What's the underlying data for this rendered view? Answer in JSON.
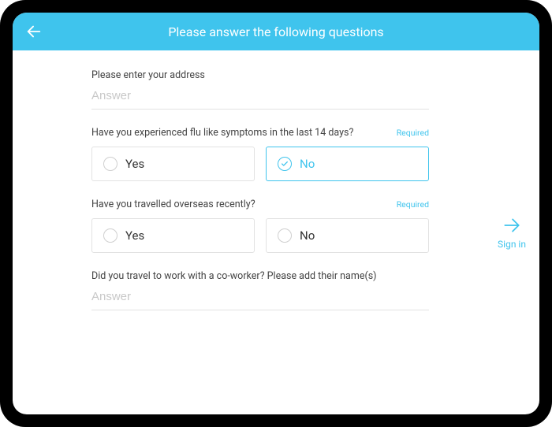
{
  "header": {
    "title": "Please answer the following questions"
  },
  "side": {
    "label": "Sign in"
  },
  "questions": {
    "q1": {
      "label": "Please enter your address",
      "placeholder": "Answer"
    },
    "q2": {
      "label": "Have you experienced flu like symptoms in the last 14 days?",
      "required_text": "Required",
      "opt_yes": "Yes",
      "opt_no": "No",
      "selected": "no"
    },
    "q3": {
      "label": "Have you travelled overseas recently?",
      "required_text": "Required",
      "opt_yes": "Yes",
      "opt_no": "No"
    },
    "q4": {
      "label": "Did you travel to work with a co-worker? Please add their name(s)",
      "placeholder": "Answer"
    }
  }
}
